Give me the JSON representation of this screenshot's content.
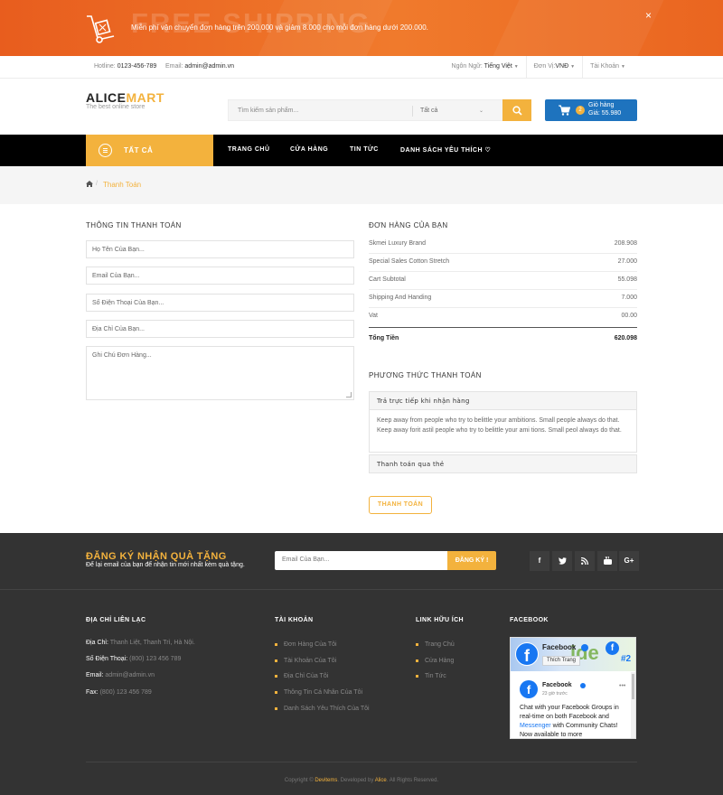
{
  "promo": {
    "big_text": "FREE SHIPPING",
    "message": "Miễn phí vận chuyển đơn hàng trên 200.000 và giảm 8.000 cho mỗi đơn hàng dưới 200.000.",
    "close": "×"
  },
  "topbar": {
    "hotline_label": "Hotline:",
    "hotline_value": "0123-456-789",
    "email_label": "Email:",
    "email_value": "admin@admin.vn",
    "language_label": "Ngôn Ngữ:",
    "language_value": "Tiếng Việt",
    "currency_label": "Đơn Vị:",
    "currency_value": "VNĐ",
    "account": "Tài Khoản"
  },
  "header": {
    "logo_a": "ALICE",
    "logo_b": "MART",
    "tagline": "The best online store",
    "search_placeholder": "Tìm kiếm sản phẩm...",
    "search_category": "Tất cả",
    "cart_count": "2",
    "cart_label": "Giỏ hàng",
    "cart_total": "Giá: 55.980"
  },
  "nav": {
    "all": "TẤT CẢ",
    "links": [
      "TRANG CHỦ",
      "CỬA HÀNG",
      "TIN TỨC",
      "DANH SÁCH YÊU THÍCH ♡"
    ]
  },
  "breadcrumb": {
    "current": "Thanh Toán"
  },
  "billing": {
    "title": "THÔNG TIN THANH TOÁN",
    "fields": [
      "Họ Tên Của Bạn...",
      "Email Của Bạn...",
      "Số Điện Thoại Của Bạn...",
      "Địa Chỉ Của Bạn..."
    ],
    "note": "Ghi Chú Đơn Hàng..."
  },
  "order": {
    "title": "ĐƠN HÀNG CỦA BẠN",
    "rows": [
      {
        "label": "Skmei Luxury Brand",
        "value": "208.908"
      },
      {
        "label": "Special Sales Cotton Stretch",
        "value": "27.000"
      },
      {
        "label": "Cart Subtotal",
        "value": "55.098"
      },
      {
        "label": "Shipping And Handing",
        "value": "7.000"
      },
      {
        "label": "Vat",
        "value": "00.00"
      }
    ],
    "total_label": "Tổng Tiền",
    "total_value": "620.098"
  },
  "payment": {
    "title": "PHƯƠNG THỨC THANH TOÁN",
    "method1": "Trả trực tiếp khi nhận hàng",
    "method1_desc": "Keep away from people who try to belittle your ambitions. Small people always do that. Keep away forit astil people who try to belittle your ami tions. Small peol always do that.",
    "method2": "Thanh toán qua thẻ",
    "button": "THANH TOÁN"
  },
  "newsletter": {
    "title": "ĐĂNG KÝ NHẬN QUÀ TẶNG",
    "subtitle": "Để lại email của bạn để nhận tin mới nhất kèm quà tặng.",
    "placeholder": "Email Của Bạn...",
    "button": "ĐĂNG KÝ !"
  },
  "social": [
    "f",
    "t",
    "rss",
    "yt",
    "G+"
  ],
  "footer": {
    "contact_title": "ĐỊA CHỈ LIÊN LẠC",
    "contact": [
      {
        "label": "Địa Chỉ:",
        "value": "Thanh Liệt, Thanh Trì, Hà Nội."
      },
      {
        "label": "Số Điện Thoại:",
        "value": "(800) 123 456 789"
      },
      {
        "label": "Email:",
        "value": "admin@admin.vn"
      },
      {
        "label": "Fax:",
        "value": "(800) 123 456 789"
      }
    ],
    "account_title": "TÀI KHOẢN",
    "account_links": [
      "Đơn Hàng Của Tôi",
      "Tài Khoản Của Tôi",
      "Địa Chỉ Của Tôi",
      "Thông Tin Cá Nhân Của Tôi",
      "Danh Sách Yêu Thích Của Tôi"
    ],
    "links_title": "LINK HỮU ÍCH",
    "links": [
      "Trang Chủ",
      "Cửa Hàng",
      "Tin Tức"
    ],
    "facebook_title": "FACEBOOK",
    "fb_page": "Facebook",
    "fb_like": "Thích Trang",
    "fb_cover_text": "ide",
    "fb_cover_num": "#2",
    "fb_post_time": "23 giờ trước",
    "fb_post_a": "Chat with your Facebook Groups in real-time on both Facebook and ",
    "fb_post_link": "Messenger",
    "fb_post_b": " with Community Chats! Now available to more",
    "copy_a": "Copyright © ",
    "copy_h1": "Devitems",
    "copy_b": ". Developed by ",
    "copy_h2": "Alice",
    "copy_c": ". All Rights Reserved."
  },
  "colors": {
    "accent": "#f3b23d",
    "promo": "#ec6a24",
    "cart": "#1e73be",
    "footer": "#333333"
  }
}
